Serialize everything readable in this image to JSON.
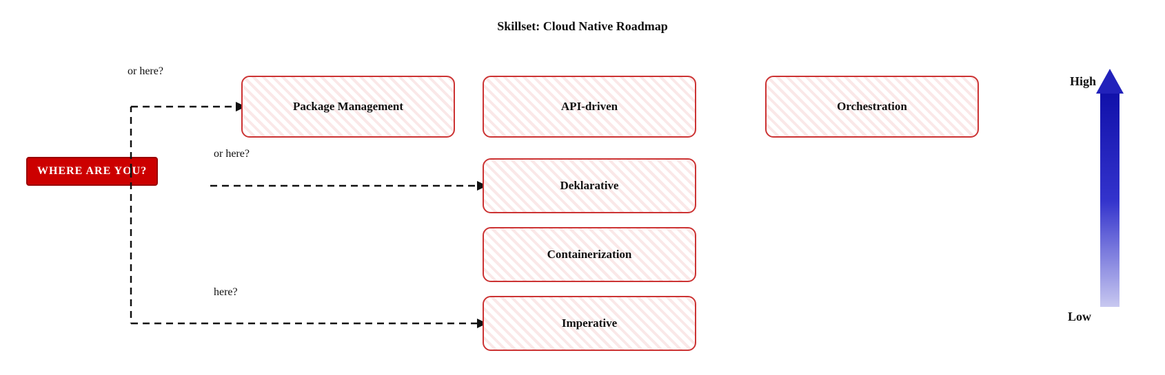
{
  "page": {
    "title": "Skillset: Cloud Native Roadmap",
    "where_label": "WHERE ARE YOU?",
    "label_or_here_top": "or here?",
    "label_or_here_mid": "or here?",
    "label_here_bot": "here?",
    "label_high": "High",
    "label_low": "Low",
    "boxes": {
      "package_management": "Package Management",
      "api_driven": "API-driven",
      "orchestration": "Orchestration",
      "deklarative": "Deklarative",
      "containerization": "Containerization",
      "imperative": "Imperative"
    }
  }
}
